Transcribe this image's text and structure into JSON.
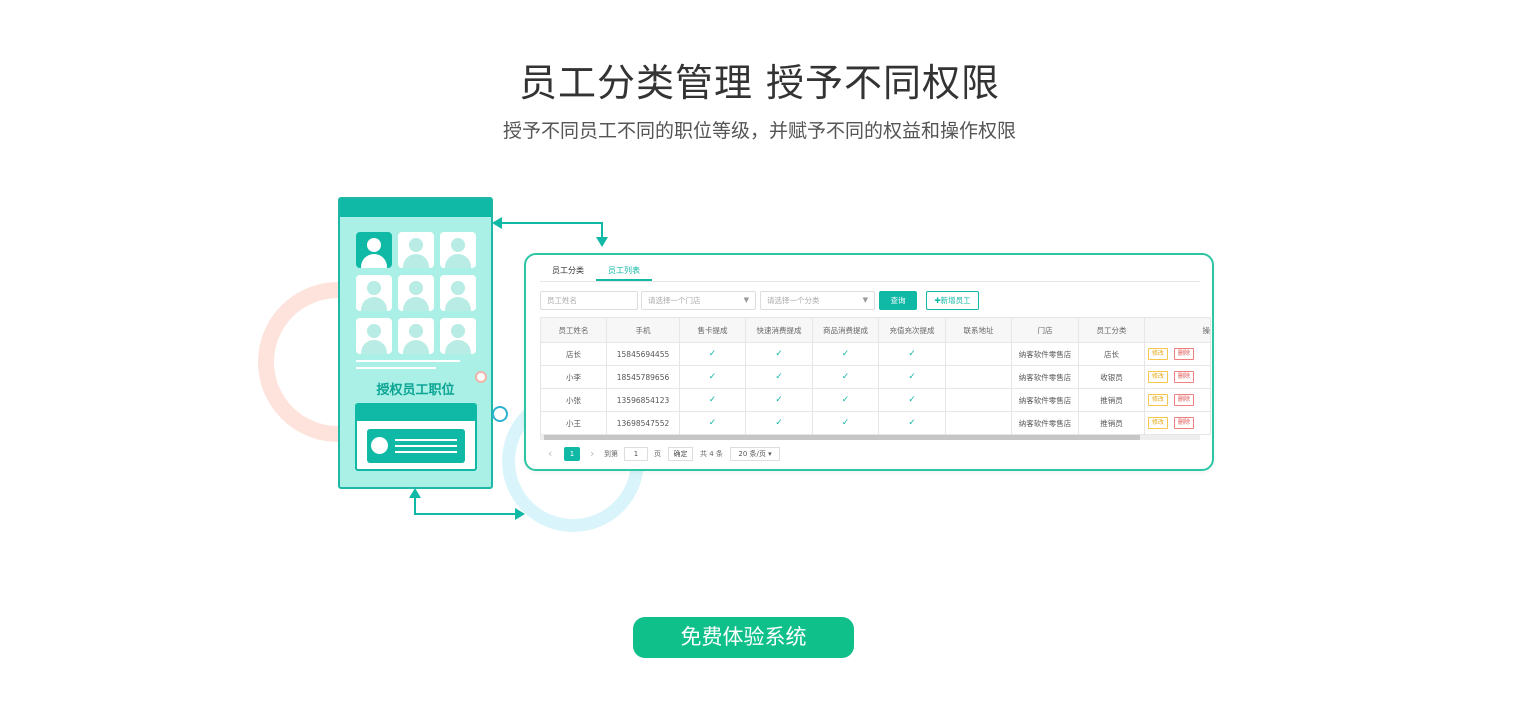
{
  "header": {
    "title": "员工分类管理 授予不同权限",
    "subtitle": "授予不同员工不同的职位等级，并赋予不同的权益和操作权限"
  },
  "phone": {
    "label": "授权员工职位"
  },
  "panel": {
    "tabs": [
      "员工分类",
      "员工列表"
    ],
    "active_tab": 1,
    "filters": {
      "name_placeholder": "员工姓名",
      "store_placeholder": "请选择一个门店",
      "category_placeholder": "请选择一个分类",
      "query_label": "查询",
      "add_label": "✚新增员工"
    },
    "table": {
      "columns": [
        "员工姓名",
        "手机",
        "售卡提成",
        "快速消费提成",
        "商品消费提成",
        "充值充次提成",
        "联系地址",
        "门店",
        "员工分类",
        "操"
      ],
      "rows": [
        {
          "name": "店长",
          "phone": "15845694455",
          "c1": "✓",
          "c2": "✓",
          "c3": "✓",
          "c4": "✓",
          "address": "",
          "store": "纳客软件零售店",
          "category": "店长",
          "edit": "修改",
          "delete": "删除"
        },
        {
          "name": "小李",
          "phone": "18545789656",
          "c1": "✓",
          "c2": "✓",
          "c3": "✓",
          "c4": "✓",
          "address": "",
          "store": "纳客软件零售店",
          "category": "收银员",
          "edit": "修改",
          "delete": "删除"
        },
        {
          "name": "小张",
          "phone": "13596854123",
          "c1": "✓",
          "c2": "✓",
          "c3": "✓",
          "c4": "✓",
          "address": "",
          "store": "纳客软件零售店",
          "category": "推销员",
          "edit": "修改",
          "delete": "删除"
        },
        {
          "name": "小王",
          "phone": "13698547552",
          "c1": "✓",
          "c2": "✓",
          "c3": "✓",
          "c4": "✓",
          "address": "",
          "store": "纳客软件零售店",
          "category": "推销员",
          "edit": "修改",
          "delete": "删除"
        }
      ]
    },
    "pagination": {
      "prev": "‹",
      "current": "1",
      "next": "›",
      "goto_label": "到第",
      "goto_value": "1",
      "page_unit": "页",
      "confirm": "确定",
      "total": "共 4 条",
      "page_size": "20 条/页 ▾"
    }
  },
  "cta": {
    "label": "免费体验系统"
  },
  "colors": {
    "accent": "#10b8a6",
    "cta": "#10c08a",
    "ring_pink": "#fde3dc",
    "ring_blue": "#daf4fb"
  }
}
